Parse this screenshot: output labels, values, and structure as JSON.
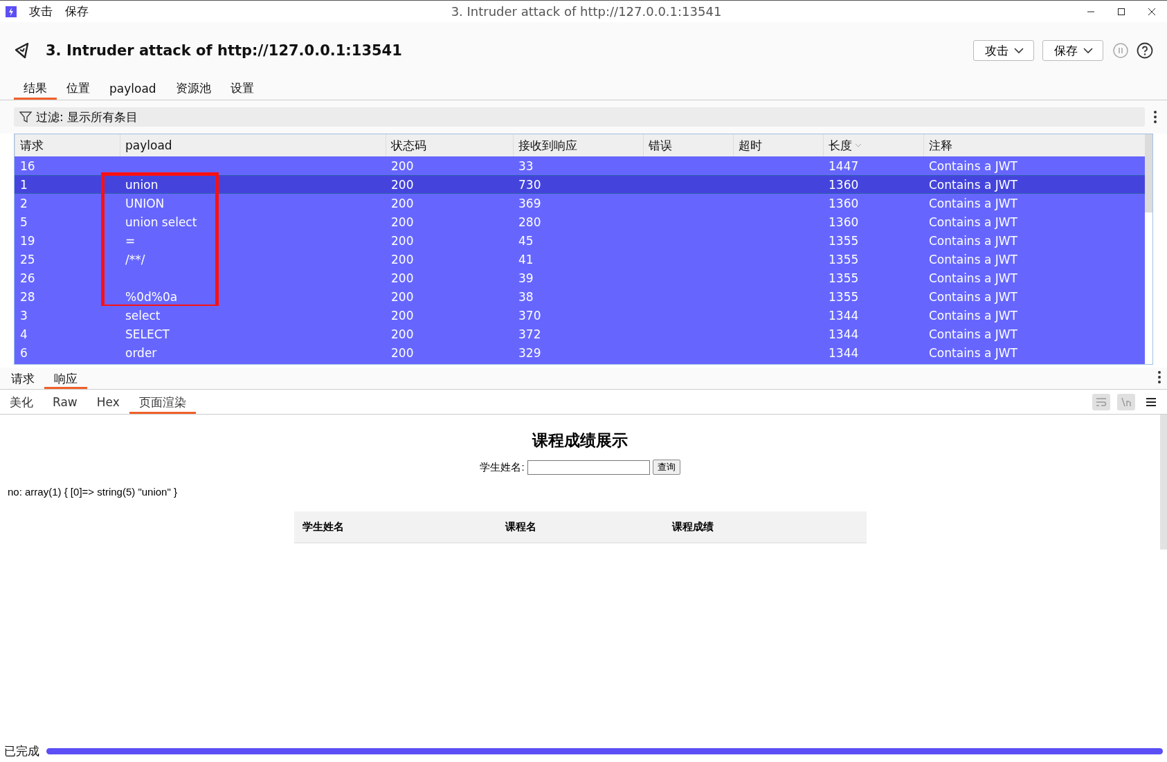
{
  "window": {
    "menu": [
      "攻击",
      "保存"
    ],
    "title": "3. Intruder attack of http://127.0.0.1:13541"
  },
  "header": {
    "title": "3. Intruder attack of http://127.0.0.1:13541",
    "buttons": [
      "攻击",
      "保存"
    ]
  },
  "tabs": [
    {
      "label": "结果",
      "selected": true
    },
    {
      "label": "位置",
      "selected": false
    },
    {
      "label": "payload",
      "selected": false
    },
    {
      "label": "资源池",
      "selected": false
    },
    {
      "label": "设置",
      "selected": false
    }
  ],
  "filter": {
    "label": "过滤: 显示所有条目"
  },
  "table": {
    "columns": [
      "请求",
      "payload",
      "状态码",
      "接收到响应",
      "错误",
      "超时",
      "长度",
      "注释"
    ],
    "rows": [
      {
        "cells": [
          "16",
          "",
          "200",
          "33",
          "",
          "",
          "1447",
          "Contains a JWT"
        ],
        "selected": false,
        "highlighted": false
      },
      {
        "cells": [
          "1",
          "union",
          "200",
          "730",
          "",
          "",
          "1360",
          "Contains a JWT"
        ],
        "selected": true,
        "highlighted": true
      },
      {
        "cells": [
          "2",
          "UNION",
          "200",
          "369",
          "",
          "",
          "1360",
          "Contains a JWT"
        ],
        "selected": false,
        "highlighted": true
      },
      {
        "cells": [
          "5",
          "union select",
          "200",
          "280",
          "",
          "",
          "1360",
          "Contains a JWT"
        ],
        "selected": false,
        "highlighted": true
      },
      {
        "cells": [
          "19",
          "=",
          "200",
          "45",
          "",
          "",
          "1355",
          "Contains a JWT"
        ],
        "selected": false,
        "highlighted": true
      },
      {
        "cells": [
          "25",
          "/**/",
          "200",
          "41",
          "",
          "",
          "1355",
          "Contains a JWT"
        ],
        "selected": false,
        "highlighted": true
      },
      {
        "cells": [
          "26",
          "",
          "200",
          "39",
          "",
          "",
          "1355",
          "Contains a JWT"
        ],
        "selected": false,
        "highlighted": true
      },
      {
        "cells": [
          "28",
          "%0d%0a",
          "200",
          "38",
          "",
          "",
          "1355",
          "Contains a JWT"
        ],
        "selected": false,
        "highlighted": true
      },
      {
        "cells": [
          "3",
          "select",
          "200",
          "370",
          "",
          "",
          "1344",
          "Contains a JWT"
        ],
        "selected": false,
        "highlighted": false
      },
      {
        "cells": [
          "4",
          "SELECT",
          "200",
          "372",
          "",
          "",
          "1344",
          "Contains a JWT"
        ],
        "selected": false,
        "highlighted": false
      },
      {
        "cells": [
          "6",
          "order",
          "200",
          "329",
          "",
          "",
          "1344",
          "Contains a JWT"
        ],
        "selected": false,
        "highlighted": false
      }
    ]
  },
  "message_tabs": [
    {
      "label": "请求",
      "selected": false
    },
    {
      "label": "响应",
      "selected": true
    }
  ],
  "view_tabs": [
    {
      "label": "美化",
      "selected": false
    },
    {
      "label": "Raw",
      "selected": false
    },
    {
      "label": "Hex",
      "selected": false
    },
    {
      "label": "页面渲染",
      "selected": true
    }
  ],
  "rendered_page": {
    "heading": "课程成绩展示",
    "field_label": "学生姓名:",
    "query_button": "查询",
    "output": "no: array(1) { [0]=> string(5) \"union\" }",
    "table_columns": [
      "学生姓名",
      "课程名",
      "课程成绩"
    ]
  },
  "status_bar": {
    "text": "已完成",
    "level": 1
  }
}
